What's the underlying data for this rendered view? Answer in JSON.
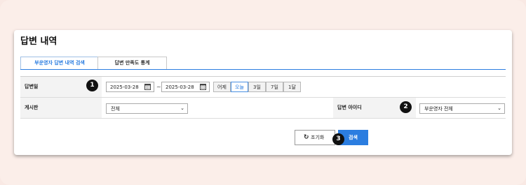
{
  "page": {
    "title": "답변 내역"
  },
  "tabs": [
    {
      "label": "부운영자 답변 내역 검색",
      "active": true
    },
    {
      "label": "답변 만족도 통계",
      "active": false
    }
  ],
  "form": {
    "answer_date": {
      "label": "답변일",
      "from": "2025-03-28",
      "separator": "~",
      "to": "2025-03-28",
      "quick_ranges": [
        "어제",
        "오늘",
        "3일",
        "7일",
        "1달"
      ],
      "selected_range": "오늘"
    },
    "board": {
      "label": "게시판",
      "selected": "전체"
    },
    "answer_id": {
      "label": "답변 아이디",
      "selected": "부운영자 전체"
    }
  },
  "actions": {
    "reset_label": "조기화",
    "search_label": "검색"
  },
  "badges": [
    "1",
    "2",
    "3"
  ],
  "colors": {
    "accent": "#2b7de0",
    "page_bg": "#fbeee9",
    "badge": "#111111"
  }
}
